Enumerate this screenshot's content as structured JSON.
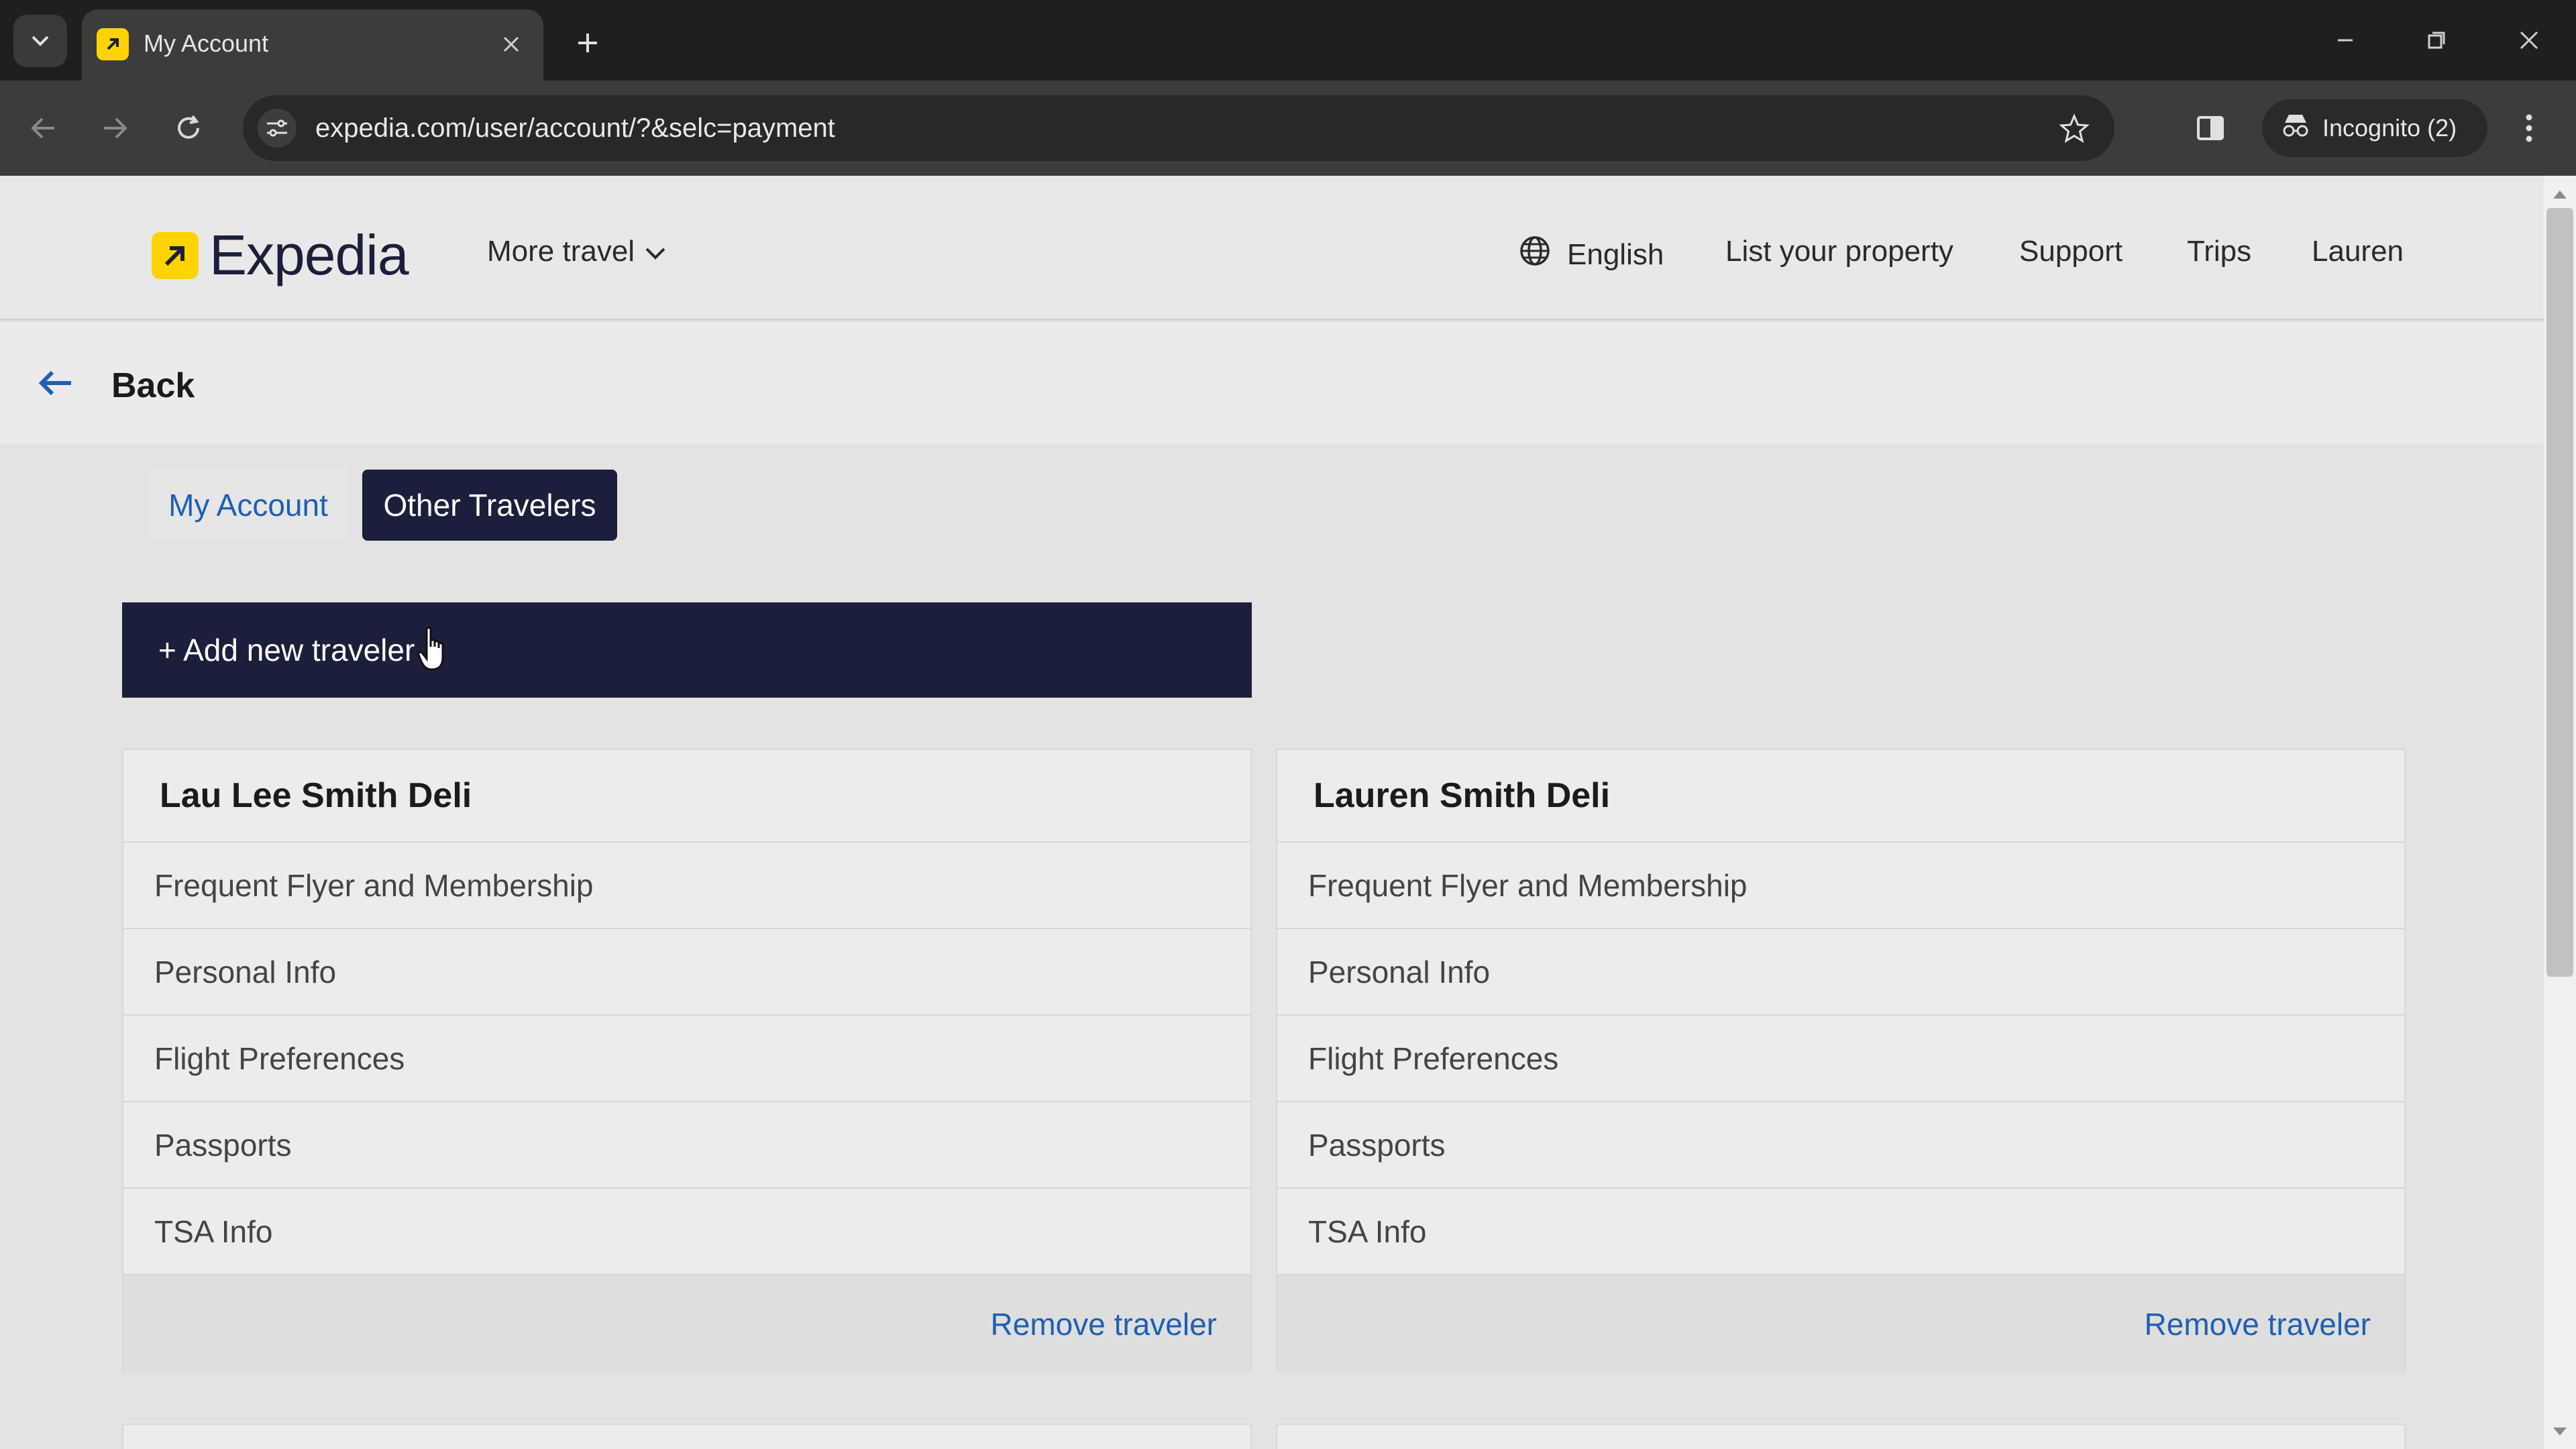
{
  "browser": {
    "tab_title": "My Account",
    "url": "expedia.com/user/account/?&selc=payment",
    "incognito_label": "Incognito (2)"
  },
  "header": {
    "logo_text": "Expedia",
    "more_travel": "More travel",
    "language": "English",
    "list_property": "List your property",
    "support": "Support",
    "trips": "Trips",
    "user": "Lauren"
  },
  "back_label": "Back",
  "tabs": {
    "my_account": "My Account",
    "other_travelers": "Other Travelers"
  },
  "add_traveler_label": "+ Add new traveler",
  "travelers": [
    {
      "name": "Lau Lee Smith Deli",
      "sections": [
        "Frequent Flyer and Membership",
        "Personal Info",
        "Flight Preferences",
        "Passports",
        "TSA Info"
      ],
      "remove_label": "Remove traveler"
    },
    {
      "name": "Lauren Smith Deli",
      "sections": [
        "Frequent Flyer and Membership",
        "Personal Info",
        "Flight Preferences",
        "Passports",
        "TSA Info"
      ],
      "remove_label": "Remove traveler"
    }
  ],
  "colors": {
    "brand_navy": "#1b1f3b",
    "brand_yellow": "#ffd300",
    "link_blue": "#1e5fb4"
  },
  "icons": [
    "tab-search-icon",
    "favicon-icon",
    "close-icon",
    "plus-icon",
    "minimize-icon",
    "restore-icon",
    "back-icon",
    "forward-icon",
    "reload-icon",
    "site-info-icon",
    "star-icon",
    "side-panel-icon",
    "incognito-icon",
    "more-icon",
    "globe-icon",
    "chevron-down-icon",
    "arrow-left-icon"
  ]
}
